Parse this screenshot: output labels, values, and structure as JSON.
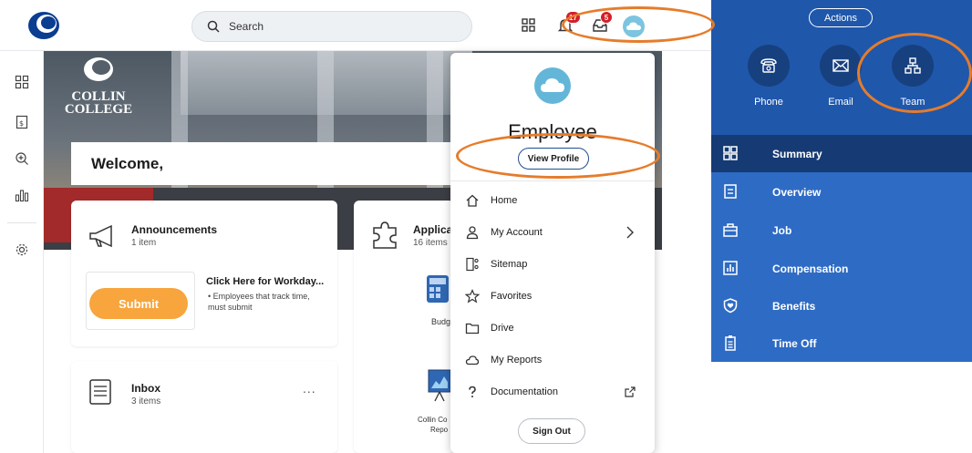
{
  "search": {
    "placeholder": "Search"
  },
  "notifications": {
    "bell_badge": "17",
    "inbox_badge": "5"
  },
  "hero": {
    "brand_line1": "COLLIN",
    "brand_line2": "COLLEGE"
  },
  "welcome": {
    "text": "Welcome,"
  },
  "announcements": {
    "title": "Announcements",
    "count": "1 item",
    "promo_title": "Click Here for Workday...",
    "promo_bullet": "Employees that track time, must submit",
    "submit_label": "Submit"
  },
  "applications": {
    "title": "Applicat",
    "count": "16 items",
    "tile1": "Budg",
    "tile2_line1": "Collin Co",
    "tile2_line2": "Repo"
  },
  "inbox": {
    "title": "Inbox",
    "count": "3 items",
    "more": "..."
  },
  "profile_menu": {
    "name": "Employee",
    "view_profile": "View Profile",
    "items": [
      {
        "label": "Home",
        "icon": "home-icon"
      },
      {
        "label": "My Account",
        "icon": "person-icon"
      },
      {
        "label": "Sitemap",
        "icon": "sitemap-icon"
      },
      {
        "label": "Favorites",
        "icon": "star-icon"
      },
      {
        "label": "Drive",
        "icon": "folder-icon"
      },
      {
        "label": "My Reports",
        "icon": "cloud-icon"
      },
      {
        "label": "Documentation",
        "icon": "question-icon"
      }
    ],
    "sign_out": "Sign Out"
  },
  "worker_panel": {
    "actions": "Actions",
    "quick_actions": [
      {
        "label": "Phone",
        "icon": "phone-icon"
      },
      {
        "label": "Email",
        "icon": "email-icon"
      },
      {
        "label": "Team",
        "icon": "team-icon"
      }
    ],
    "nav": [
      {
        "label": "Summary",
        "icon": "summary-icon",
        "active": true
      },
      {
        "label": "Overview",
        "icon": "overview-icon"
      },
      {
        "label": "Job",
        "icon": "job-icon"
      },
      {
        "label": "Compensation",
        "icon": "compensation-icon"
      },
      {
        "label": "Benefits",
        "icon": "benefits-icon"
      },
      {
        "label": "Time Off",
        "icon": "time-off-icon"
      }
    ]
  },
  "colors": {
    "highlight": "#e67c2b",
    "panel_blue": "#2e6bc4",
    "panel_dark": "#163a73",
    "submit_orange": "#f7a53c",
    "badge_red": "#d41f28"
  }
}
